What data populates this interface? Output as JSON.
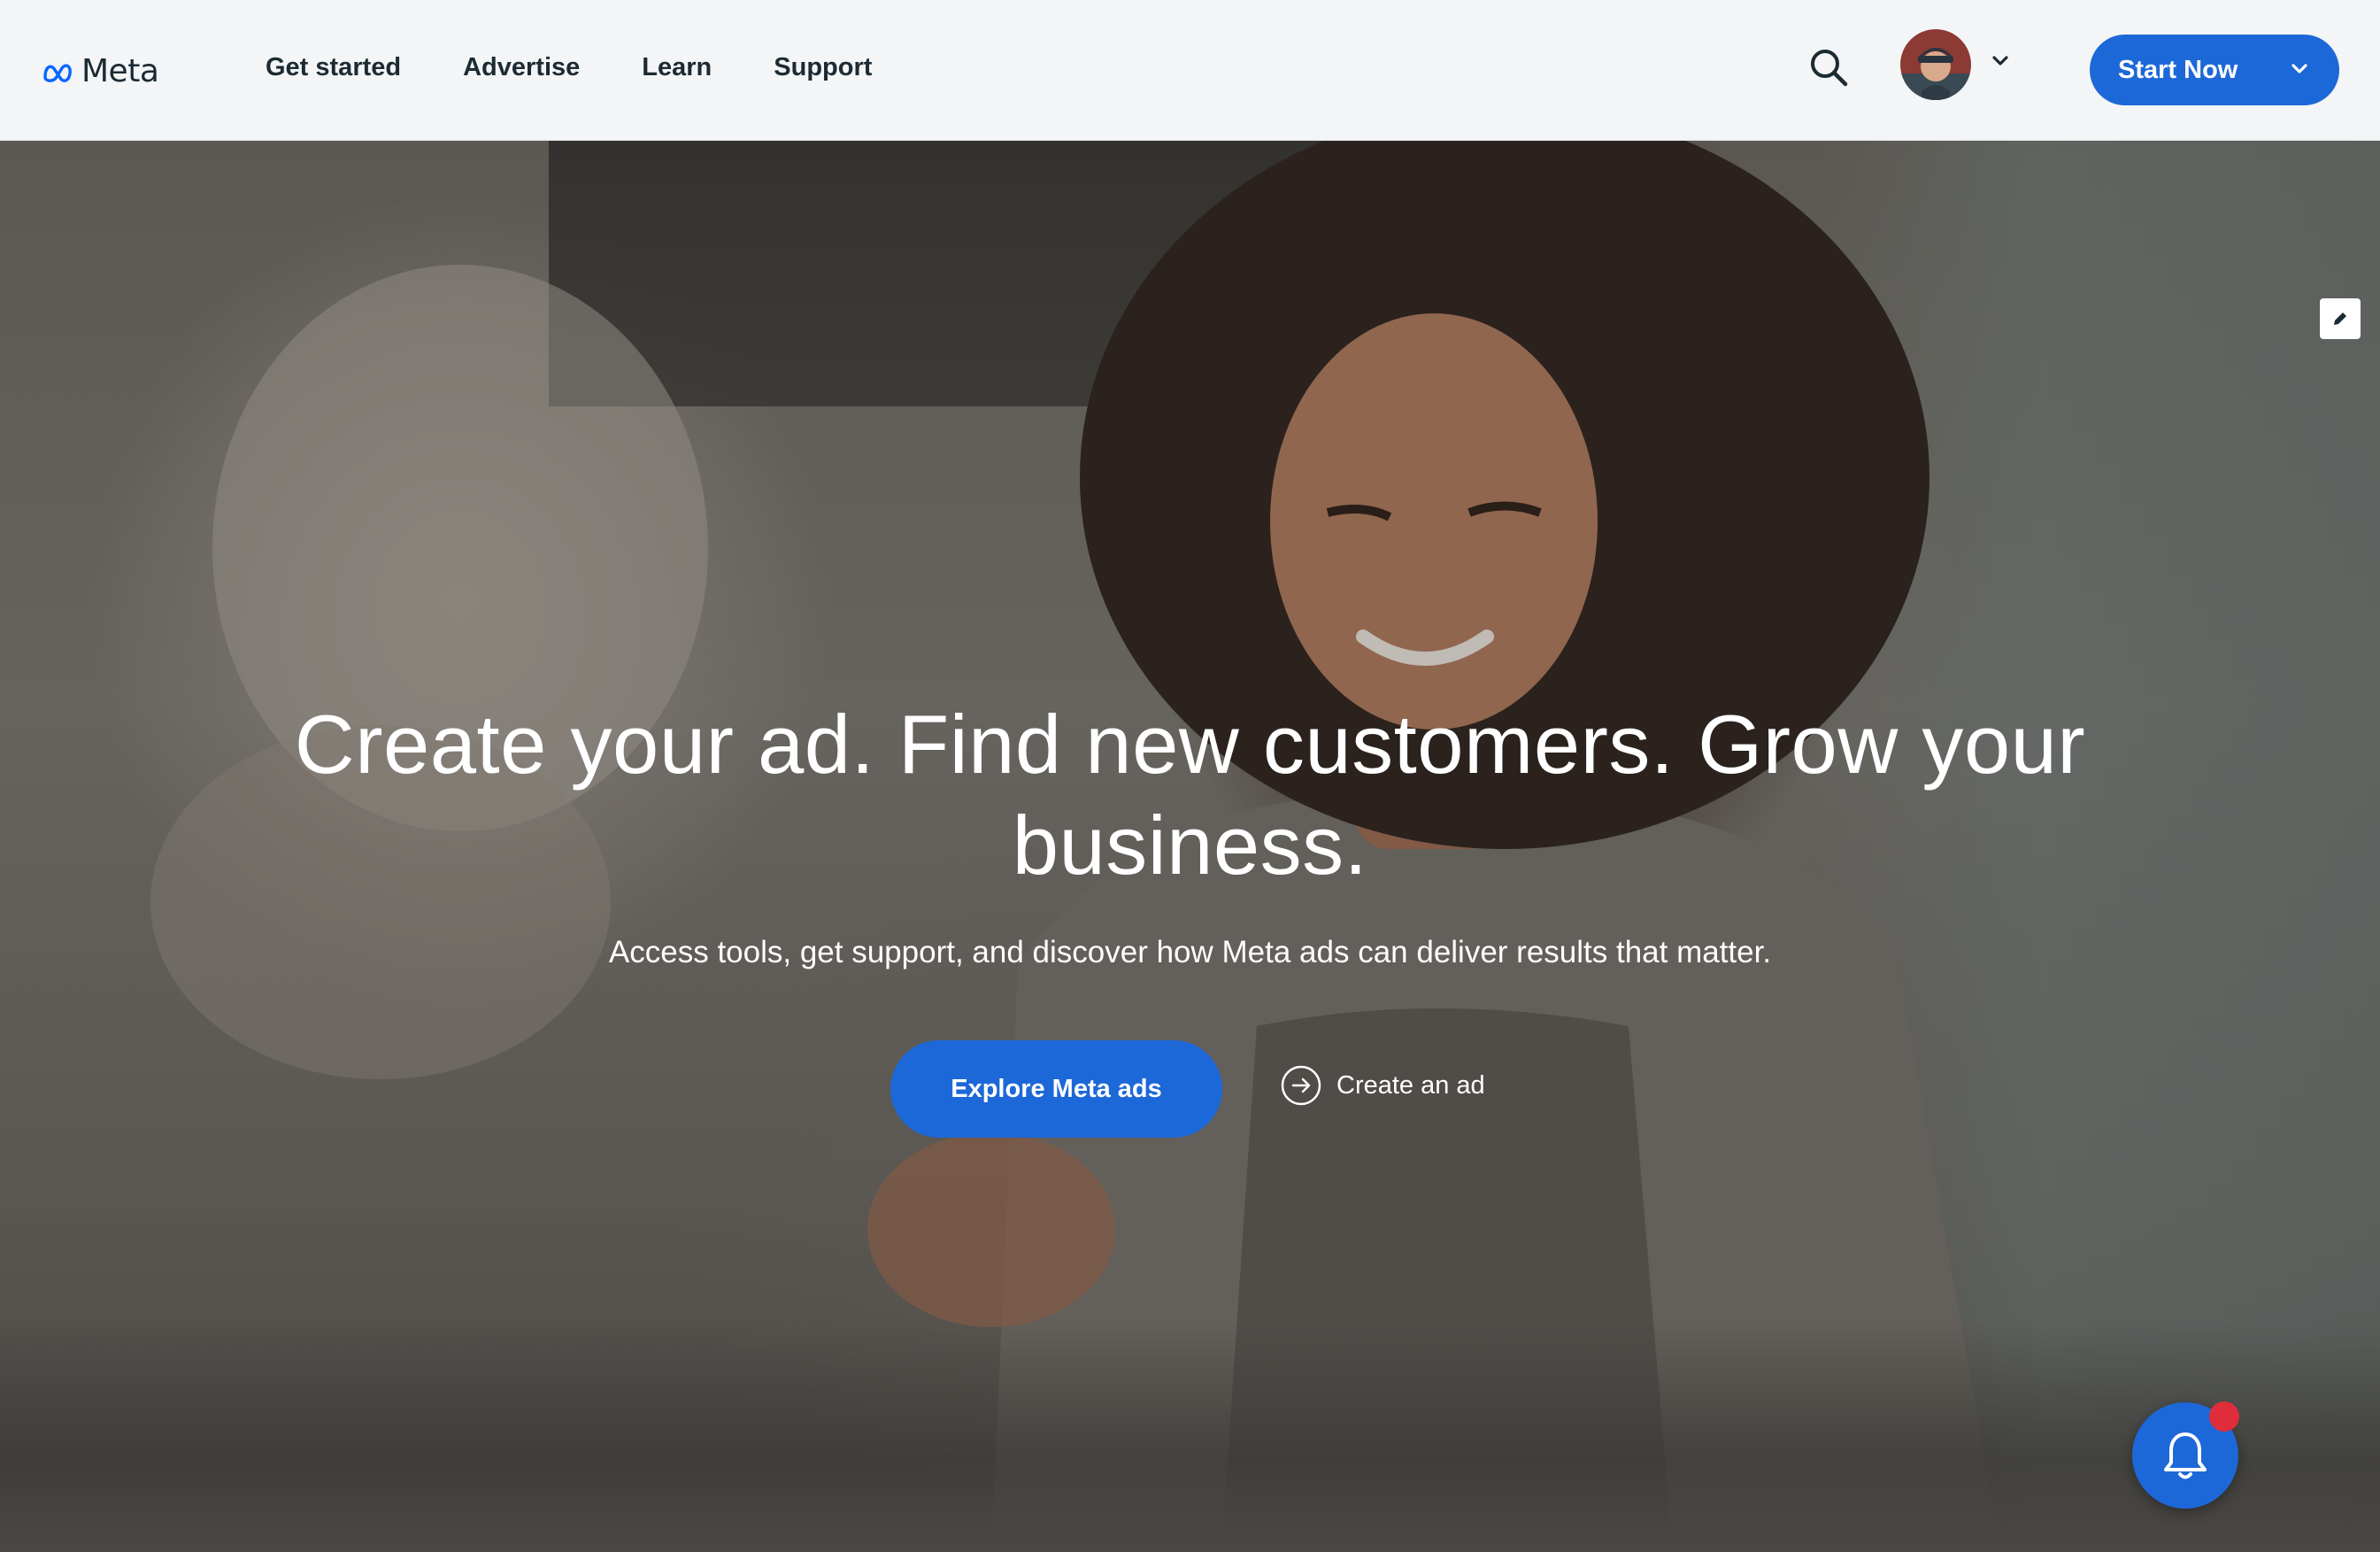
{
  "header": {
    "logo_text": "Meta",
    "nav": [
      "Get started",
      "Advertise",
      "Learn",
      "Support"
    ],
    "start_button": "Start Now"
  },
  "hero": {
    "headline": "Create your ad. Find new customers. Grow your business.",
    "subheadline": "Access tools, get support, and discover how Meta ads can deliver results that matter.",
    "primary_cta": "Explore Meta ads",
    "secondary_cta": "Create an ad"
  },
  "colors": {
    "accent": "#1d68d8",
    "notification_dot": "#e02d3c",
    "text_dark": "#1c2b33"
  },
  "icons": [
    "meta-logo-icon",
    "search-icon",
    "chevron-down-icon",
    "pencil-icon",
    "arrow-right-circle-icon",
    "bell-icon"
  ]
}
